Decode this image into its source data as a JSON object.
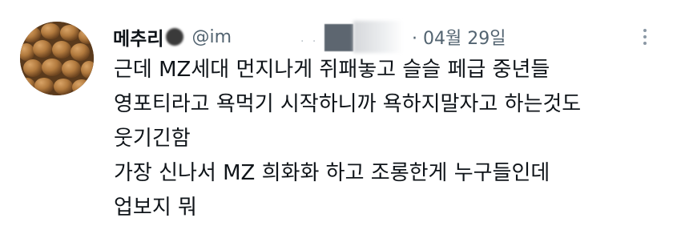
{
  "tweet": {
    "display_name": "메추리",
    "handle": "@im",
    "date": "· 04월 29일",
    "more_icon": "more-dots-icon",
    "avatar_icon": "quail-eggs-avatar",
    "lines": [
      "근데 MZ세대 먼지나게 쥐패놓고 슬슬 페급 중년들",
      "영포티라고 욕먹기 시작하니까 욕하지말자고 하는것도",
      "웃기긴함",
      "가장 신나서 MZ 희화화 하고 조롱한게 누구들인데",
      "업보지 뭐"
    ]
  },
  "colors": {
    "text": "#0f1419",
    "muted": "#536471",
    "background": "#ffffff"
  }
}
